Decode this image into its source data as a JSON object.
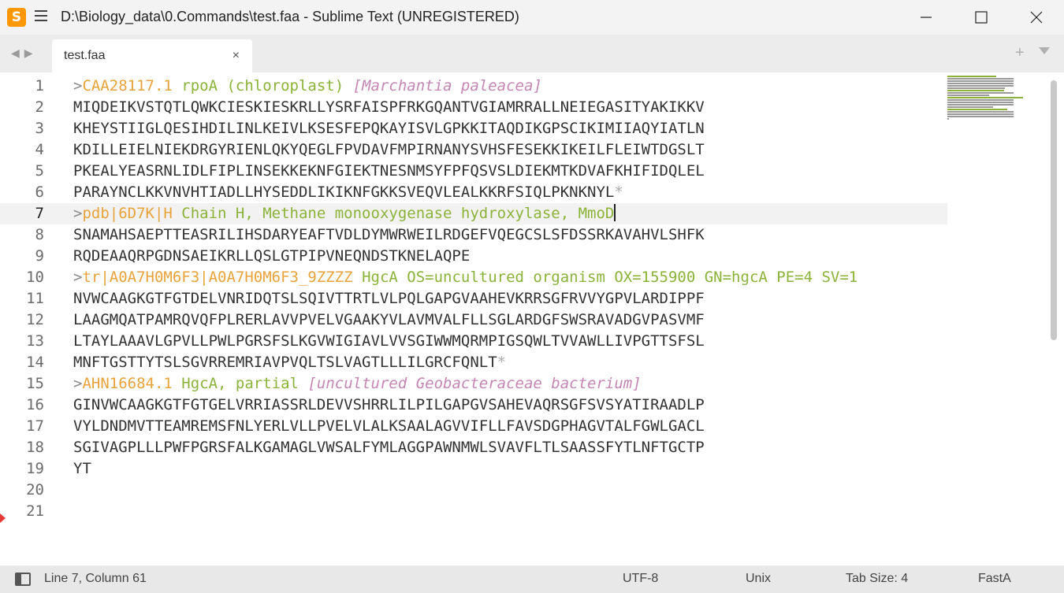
{
  "window": {
    "title": "D:\\Biology_data\\0.Commands\\test.faa - Sublime Text (UNREGISTERED)",
    "logo_letter": "S"
  },
  "tabs": {
    "active_label": "test.faa",
    "close_glyph": "×",
    "add_glyph": "+"
  },
  "editor": {
    "line_numbers": [
      "1",
      "2",
      "3",
      "4",
      "5",
      "6",
      "7",
      "8",
      "9",
      "10",
      "11",
      "12",
      "13",
      "14",
      "15",
      "16",
      "17",
      "18",
      "19",
      "20",
      "21"
    ],
    "active_line": 7,
    "lines": [
      [
        {
          "t": ">",
          "c": "g"
        },
        {
          "t": "CAA28117.1",
          "c": "o"
        },
        {
          "t": " rpoA (chloroplast) ",
          "c": "gr"
        },
        {
          "t": "[Marchantia paleacea]",
          "c": "pk"
        }
      ],
      [
        {
          "t": "MIQDEIKVSTQTLQWKCIESKIESKRLLYSRFAISPFRKGQANTVGIAMRRALLNEIEGASITYAKIKKV",
          "c": ""
        }
      ],
      [
        {
          "t": "KHEYSTIIGLQESIHDILINLKEIVLKSESFEPQKAYISVLGPKKITAQDIKGPSCIKIMIIAQYIATLN",
          "c": ""
        }
      ],
      [
        {
          "t": "KDILLEIELNIEKDRGYRIENLQKYQEGLFPVDAVFMPIRNANYSVHSFESEKKIKEILFLEIWTDGSLT",
          "c": ""
        }
      ],
      [
        {
          "t": "PKEALYEASRNLIDLFIPLINSEKKEKNFGIEKTNESNMSYFPFQSVSLDIEKMTKDVAFKHIFIDQLEL",
          "c": ""
        }
      ],
      [
        {
          "t": "PARAYNCLKKVNVHTIADLLHYSEDDLIKIKNFGKKSVEQVLEALKKRFSIQLPKNKNYL",
          "c": ""
        },
        {
          "t": "*",
          "c": "ast"
        }
      ],
      [
        {
          "t": ">",
          "c": "g"
        },
        {
          "t": "pdb|6D7K|H",
          "c": "o"
        },
        {
          "t": " Chain H, Methane monooxygenase hydroxylase, MmoD",
          "c": "gr"
        }
      ],
      [
        {
          "t": "SNAMAHSAEPTTEASRILIHSDARYEAFTVDLDYMWRWEILRDGEFVQEGCSLSFDSSRKAVAHVLSHFK",
          "c": ""
        }
      ],
      [
        {
          "t": "RQDEAAQRPGDNSAEIKRLLQSLGTPIPVNEQNDSTKNELAQPE",
          "c": ""
        }
      ],
      [
        {
          "t": ">",
          "c": "g"
        },
        {
          "t": "tr|A0A7H0M6F3|A0A7H0M6F3_9ZZZZ",
          "c": "o"
        },
        {
          "t": " HgcA OS=uncultured organism OX=155900 GN=hgcA PE=4 SV=1",
          "c": "gr"
        }
      ],
      [
        {
          "t": "NVWCAAGKGTFGTDELVNRIDQTSLSQIVTTRTLVLPQLGAPGVAAHEVKRRSGFRVVYGPVLARDIPPF",
          "c": ""
        }
      ],
      [
        {
          "t": "LAAGMQATPAMRQVQFPLRERLAVVPVELVGAAKYVLAVMVALFLLSGLARDGFSWSRAVADGVPASVMF",
          "c": ""
        }
      ],
      [
        {
          "t": "LTAYLAAAVLGPVLLPWLPGRSFSLKGVWIGIAVLVVSGIWWMQRMPIGSQWLTVVAWLLIVPGTTSFSL",
          "c": ""
        }
      ],
      [
        {
          "t": "MNFTGSTTYTSLSGVRREMRIAVPVQLTSLVAGTLLLILGRCFQNLT",
          "c": ""
        },
        {
          "t": "*",
          "c": "ast"
        }
      ],
      [
        {
          "t": ">",
          "c": "g"
        },
        {
          "t": "AHN16684.1",
          "c": "o"
        },
        {
          "t": " HgcA, partial ",
          "c": "gr"
        },
        {
          "t": "[uncultured Geobacteraceae bacterium]",
          "c": "pk"
        }
      ],
      [
        {
          "t": "GINVWCAAGKGTFGTGELVRRIASSRLDEVVSHRRLILPILGAPGVSAHEVAQRSGFSVSYATIRAADLP",
          "c": ""
        }
      ],
      [
        {
          "t": "VYLDNDMVTTEAMREMSFNLYERLVLLPVELVLALKSAALAGVVIFLLFAVSDGPHAGVTALFGWLGACL",
          "c": ""
        }
      ],
      [
        {
          "t": "SGIVAGPLLLPWFPGRSFALKGAMAGLVWSALFYMLAGGPAWNMWLSVAVFLTLSAASSFYTLNFTGCTP",
          "c": ""
        }
      ],
      [
        {
          "t": "YT",
          "c": ""
        }
      ],
      [],
      []
    ]
  },
  "status": {
    "position": "Line 7, Column 61",
    "encoding": "UTF-8",
    "line_endings": "Unix",
    "tab_size": "Tab Size: 4",
    "syntax": "FastA"
  },
  "colors": {
    "header_marker": "#8a8a8a",
    "accession": "#e8a33c",
    "description": "#8bb33a",
    "organism": "#c586b4",
    "stop": "#aaaaaa"
  }
}
